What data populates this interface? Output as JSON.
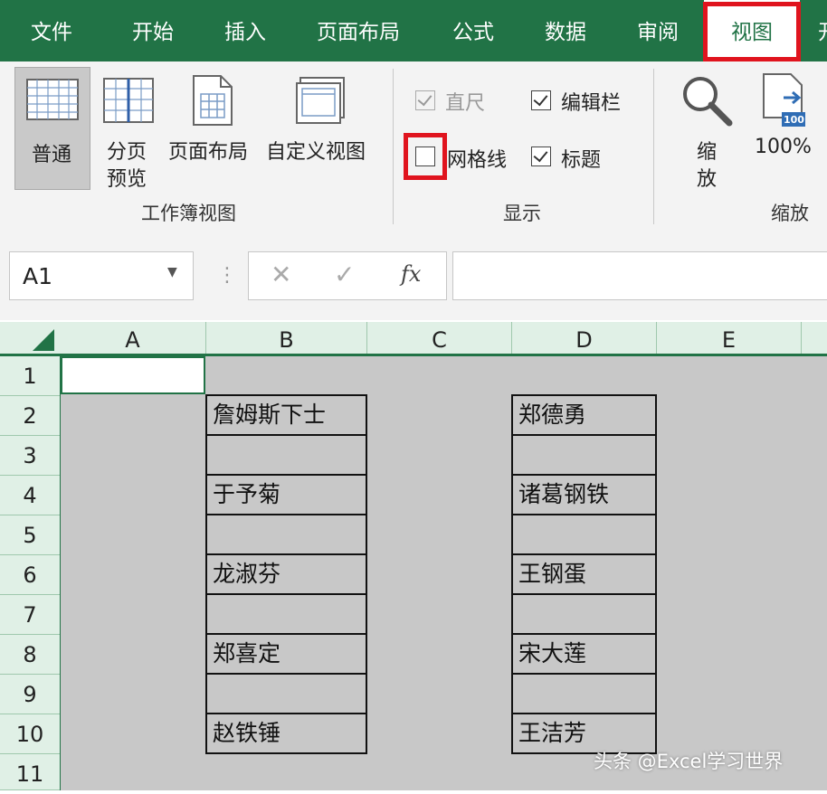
{
  "ribbon_tabs": [
    "文件",
    "开始",
    "插入",
    "页面布局",
    "公式",
    "数据",
    "审阅",
    "视图",
    "开"
  ],
  "active_tab": "视图",
  "workbook_views": {
    "group_label": "工作簿视图",
    "normal": "普通",
    "page_break_preview_1": "分页",
    "page_break_preview_2": "预览",
    "page_layout": "页面布局",
    "custom_views": "自定义视图"
  },
  "show": {
    "group_label": "显示",
    "ruler": "直尺",
    "formula_bar": "编辑栏",
    "gridlines": "网格线",
    "headings": "标题",
    "ruler_checked": true,
    "formula_bar_checked": true,
    "gridlines_checked": false,
    "headings_checked": true
  },
  "zoom": {
    "group_label": "缩放",
    "zoom_1": "缩",
    "zoom_2": "放",
    "hundred": "100%",
    "icon_badge": "100"
  },
  "formula_bar": {
    "name_box": "A1",
    "fx": "fx",
    "formula_value": ""
  },
  "sheet": {
    "columns": [
      "A",
      "B",
      "C",
      "D",
      "E"
    ],
    "rows": [
      "1",
      "2",
      "3",
      "4",
      "5",
      "6",
      "7",
      "8",
      "9",
      "10",
      "11"
    ],
    "column_b": [
      "詹姆斯下士",
      "",
      "于予菊",
      "",
      "龙淑芬",
      "",
      "郑喜定",
      "",
      "赵铁锤"
    ],
    "column_d": [
      "郑德勇",
      "",
      "诸葛钢铁",
      "",
      "王钢蛋",
      "",
      "宋大莲",
      "",
      "王洁芳"
    ]
  },
  "watermark": "头条 @Excel学习世界",
  "colors": {
    "ribbon_green": "#217346",
    "highlight_red": "#e0141e",
    "sheet_gray": "#c8c8c8",
    "header_green": "#e0f0e6"
  }
}
